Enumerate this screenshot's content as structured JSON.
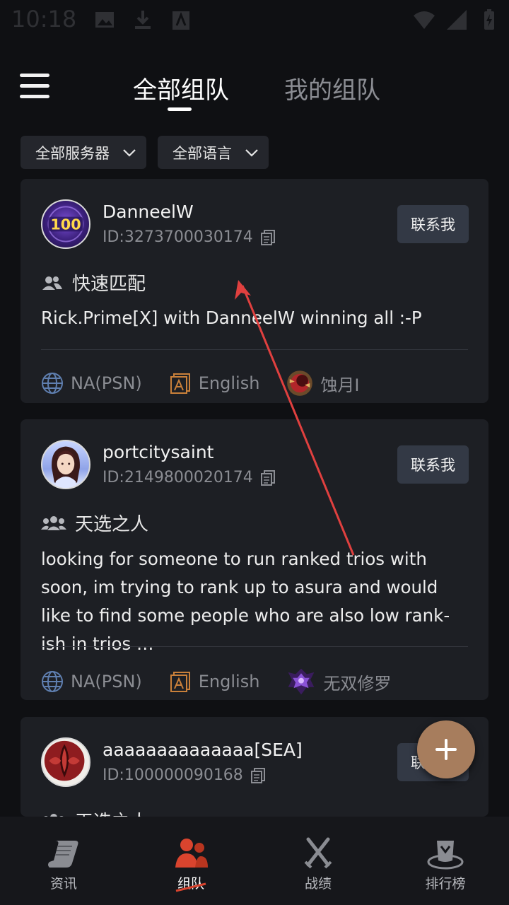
{
  "status_bar": {
    "time": "10:18"
  },
  "header": {
    "tabs": [
      {
        "label": "全部组队",
        "active": true
      },
      {
        "label": "我的组队",
        "active": false
      }
    ]
  },
  "filters": [
    {
      "label": "全部服务器"
    },
    {
      "label": "全部语言"
    }
  ],
  "posts": [
    {
      "username": "DanneelW",
      "id": "ID:3273700030174",
      "contact_label": "联系我",
      "mode": "快速匹配",
      "description": "Rick.Prime[X] with DanneelW  winning all :-P",
      "server": "NA(PSN)",
      "language": "English",
      "rank": "蚀月I",
      "avatar_badge": "100"
    },
    {
      "username": "portcitysaint",
      "id": "ID:2149800020174",
      "contact_label": "联系我",
      "mode": "天选之人",
      "description": "looking for someone to run ranked trios with soon, im trying to rank up to asura and would like to find some people who are also low rank-ish in trios …",
      "server": "NA(PSN)",
      "language": "English",
      "rank": "无双修罗"
    },
    {
      "username": "aaaaaaaaaaaaaa[SEA]",
      "id": "ID:100000090168",
      "contact_label": "联系我",
      "mode": "天选之人"
    }
  ],
  "fab": {
    "icon": "plus-icon"
  },
  "bottom_nav": [
    {
      "label": "资讯",
      "icon": "scroll-icon",
      "active": false
    },
    {
      "label": "组队",
      "icon": "team-icon",
      "active": true
    },
    {
      "label": "战绩",
      "icon": "crossed-swords-icon",
      "active": false
    },
    {
      "label": "排行榜",
      "icon": "ranking-emblem-icon",
      "active": false
    }
  ],
  "colors": {
    "background": "#0f1013",
    "card": "#1d1f24",
    "button": "#333945",
    "fab": "#a77d5d",
    "annotation_arrow": "#e0403f",
    "active_nav": "#d9442e"
  }
}
